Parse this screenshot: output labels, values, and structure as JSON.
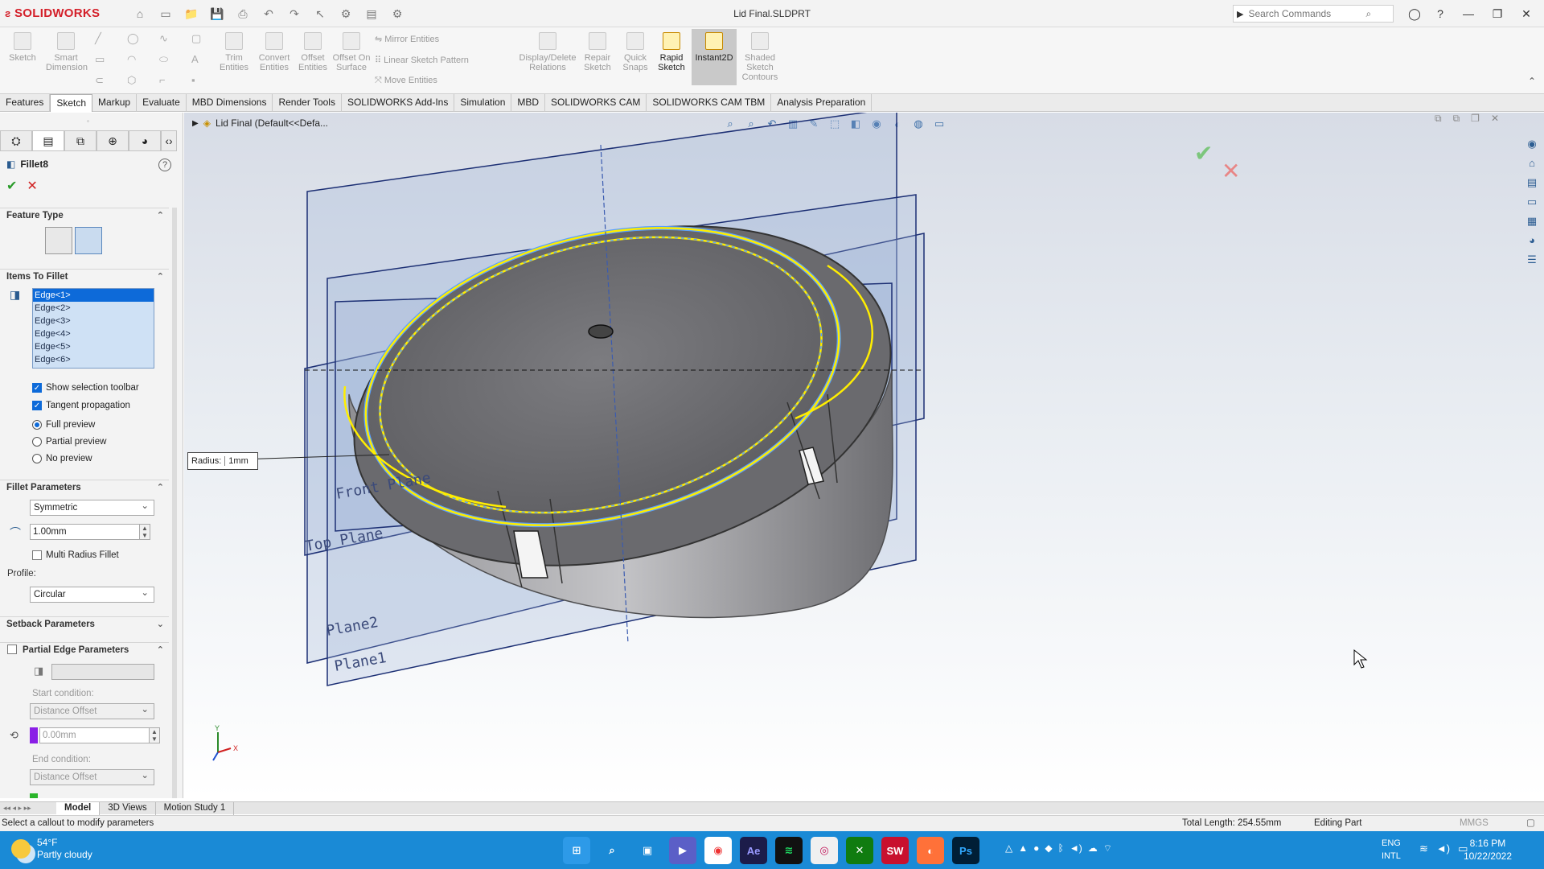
{
  "app": {
    "logo": "SOLIDWORKS",
    "doc_title": "Lid Final.SLDPRT",
    "search_placeholder": "Search Commands"
  },
  "commands": [
    {
      "label": "Sketch",
      "state": "disabled"
    },
    {
      "label": "Smart Dimension",
      "state": "disabled"
    },
    {
      "label": "Trim Entities",
      "state": "disabled"
    },
    {
      "label": "Convert Entities",
      "state": "disabled"
    },
    {
      "label": "Offset Entities",
      "state": "disabled"
    },
    {
      "label": "Offset On Surface",
      "state": "disabled"
    },
    {
      "label": "Display/Delete Relations",
      "state": "disabled"
    },
    {
      "label": "Repair Sketch",
      "state": "disabled"
    },
    {
      "label": "Quick Snaps",
      "state": "disabled"
    },
    {
      "label": "Rapid Sketch",
      "state": "active"
    },
    {
      "label": "Instant2D",
      "state": "pressed"
    },
    {
      "label": "Shaded Sketch Contours",
      "state": "disabled"
    }
  ],
  "list_commands": [
    "Mirror Entities",
    "Linear Sketch Pattern",
    "Move Entities"
  ],
  "cm_tabs": [
    "Features",
    "Sketch",
    "Markup",
    "Evaluate",
    "MBD Dimensions",
    "Render Tools",
    "SOLIDWORKS Add-Ins",
    "Simulation",
    "MBD",
    "SOLIDWORKS CAM",
    "SOLIDWORKS CAM TBM",
    "Analysis Preparation"
  ],
  "cm_active_tab": "Sketch",
  "property_manager": {
    "feature_name": "Fillet8",
    "feature_type": {
      "title": "Feature Type"
    },
    "items_to_fillet": {
      "title": "Items To Fillet",
      "edges": [
        "Edge<1>",
        "Edge<2>",
        "Edge<3>",
        "Edge<4>",
        "Edge<5>",
        "Edge<6>"
      ],
      "selected_index": 0
    },
    "options": [
      {
        "label": "Show selection toolbar",
        "checked": true
      },
      {
        "label": "Tangent propagation",
        "checked": true
      }
    ],
    "preview": [
      {
        "label": "Full preview",
        "selected": true
      },
      {
        "label": "Partial preview",
        "selected": false
      },
      {
        "label": "No preview",
        "selected": false
      }
    ],
    "fillet_parameters": {
      "title": "Fillet Parameters",
      "method": "Symmetric",
      "radius": "1.00mm",
      "multi_radius_label": "Multi Radius Fillet",
      "profile_label": "Profile:",
      "profile": "Circular"
    },
    "setback": {
      "title": "Setback Parameters"
    },
    "partial_edge": {
      "title": "Partial Edge Parameters",
      "start_label": "Start condition:",
      "start_condition": "Distance Offset",
      "start_value": "0.00mm",
      "end_label": "End condition:",
      "end_condition": "Distance Offset"
    }
  },
  "viewport": {
    "breadcrumb": "Lid Final  (Default<<Defa...",
    "callout_label": "Radius:",
    "callout_value": "1mm",
    "planes": [
      "Front Plane",
      "Top Plane",
      "Plane2",
      "Plane1"
    ],
    "triad": {
      "y": "Y",
      "x": "X"
    }
  },
  "bottom_tabs": [
    "Model",
    "3D Views",
    "Motion Study 1"
  ],
  "bottom_active": "Model",
  "status": {
    "message": "Select a callout to modify parameters",
    "total_length": "Total Length: 254.55mm",
    "mode": "Editing Part",
    "units": "MMGS"
  },
  "taskbar": {
    "temp": "54°F",
    "weather": "Partly cloudy",
    "lang1": "ENG",
    "lang2": "INTL",
    "time": "8:16 PM",
    "date": "10/22/2022"
  }
}
